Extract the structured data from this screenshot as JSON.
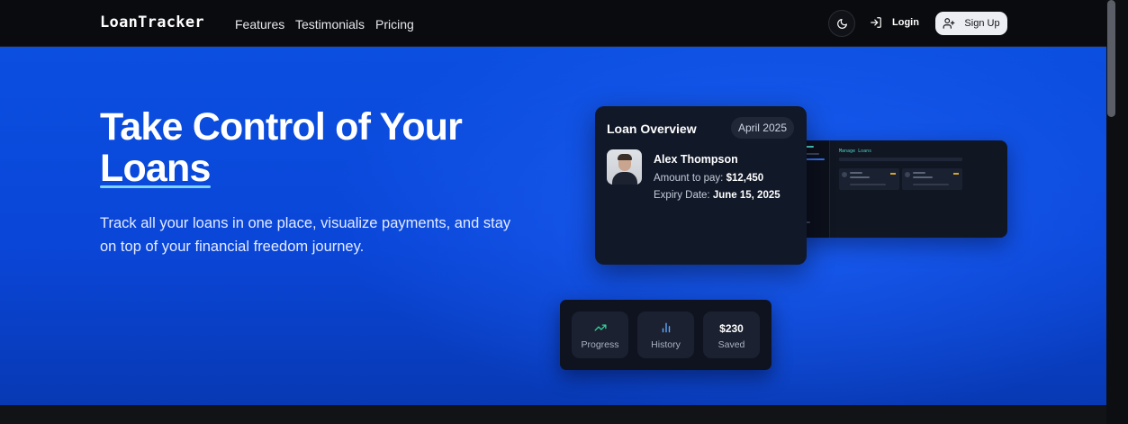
{
  "nav": {
    "brand": "LoanTracker",
    "links": [
      "Features",
      "Testimonials",
      "Pricing"
    ],
    "theme_icon": "moon-icon",
    "login_label": "Login",
    "login_icon": "log-in-icon",
    "signup_label": "Sign Up",
    "signup_icon": "user-plus-icon"
  },
  "hero": {
    "title_line1": "Take Control of Your",
    "title_line2": "Loans",
    "subtitle": "Track all your loans in one place, visualize payments, and stay on top of your financial freedom journey."
  },
  "loan_card": {
    "title": "Loan Overview",
    "month": "April 2025",
    "name": "Alex Thompson",
    "amount_label": "Amount to pay:",
    "amount_value": "$12,450",
    "expiry_label": "Expiry Date:",
    "expiry_value": "June 15, 2025"
  },
  "mini_preview": {
    "title": "Manage Loans"
  },
  "stats": [
    {
      "icon": "trending-up-icon",
      "label": "Progress",
      "color": "#34d399"
    },
    {
      "icon": "bar-chart-icon",
      "label": "History",
      "color": "#60a5fa"
    },
    {
      "value": "$230",
      "label": "Saved"
    }
  ],
  "colors": {
    "hero_blue": "#0b4fe0",
    "underline_accent": "#7dd3fc",
    "card_bg": "#111828"
  }
}
